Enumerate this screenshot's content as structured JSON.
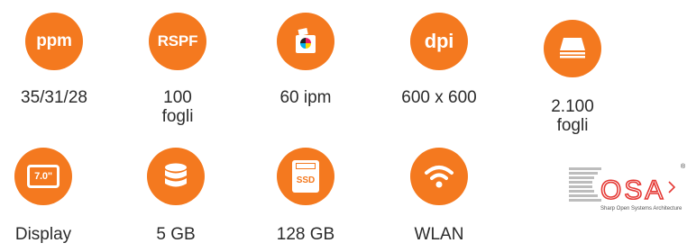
{
  "specs": [
    {
      "icon": "ppm-icon",
      "icon_text": "ppm",
      "label": "35/31/28"
    },
    {
      "icon": "rspf-icon",
      "icon_text": "RSPF",
      "label": "100\nfogli"
    },
    {
      "icon": "color-print-icon",
      "icon_text": "",
      "label": "60 ipm"
    },
    {
      "icon": "dpi-icon",
      "icon_text": "dpi",
      "label": "600 x 600"
    },
    {
      "icon": "paper-tray-icon",
      "icon_text": "",
      "label": "2.100\nfogli"
    },
    {
      "icon": "display-icon",
      "icon_text": "7.0\"",
      "label": "Display"
    },
    {
      "icon": "storage-icon",
      "icon_text": "",
      "label": "5 GB"
    },
    {
      "icon": "ssd-icon",
      "icon_text": "SSD",
      "label": "128 GB"
    },
    {
      "icon": "wifi-icon",
      "icon_text": "",
      "label": "WLAN"
    }
  ],
  "osa": {
    "logo_text": "OSA",
    "tagline": "Sharp Open Systems Architecture",
    "reg": "®"
  },
  "colors": {
    "accent": "#f4791f",
    "text": "#2b2b2b"
  }
}
